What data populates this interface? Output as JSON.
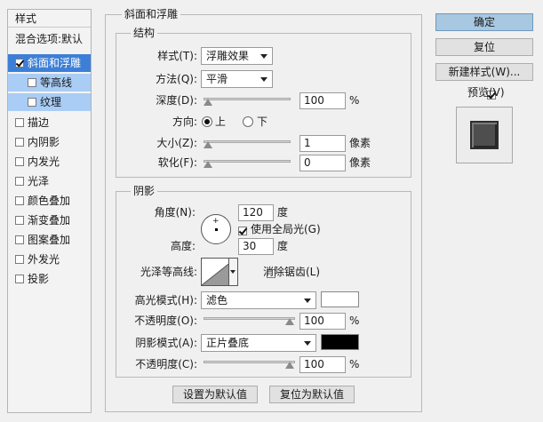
{
  "style_list": {
    "header": "样式",
    "blend_options": "混合选项:默认",
    "items": [
      {
        "label": "斜面和浮雕",
        "checked": true
      },
      {
        "label": "等高线",
        "checked": false
      },
      {
        "label": "纹理",
        "checked": false
      },
      {
        "label": "描边",
        "checked": false
      },
      {
        "label": "内阴影",
        "checked": false
      },
      {
        "label": "内发光",
        "checked": false
      },
      {
        "label": "光泽",
        "checked": false
      },
      {
        "label": "颜色叠加",
        "checked": false
      },
      {
        "label": "渐变叠加",
        "checked": false
      },
      {
        "label": "图案叠加",
        "checked": false
      },
      {
        "label": "外发光",
        "checked": false
      },
      {
        "label": "投影",
        "checked": false
      }
    ]
  },
  "panel": {
    "title": "斜面和浮雕",
    "structure": {
      "title": "结构",
      "style_label": "样式(T):",
      "style_value": "浮雕效果",
      "technique_label": "方法(Q):",
      "technique_value": "平滑",
      "depth_label": "深度(D):",
      "depth_value": "100",
      "depth_unit": "%",
      "depth_level": 0.0,
      "direction_label": "方向:",
      "direction_up": "上",
      "direction_down": "下",
      "size_label": "大小(Z):",
      "size_value": "1",
      "size_unit": "像素",
      "size_level": 0.0,
      "soften_label": "软化(F):",
      "soften_value": "0",
      "soften_unit": "像素",
      "soften_level": 0.0
    },
    "shading": {
      "title": "阴影",
      "angle_label": "角度(N):",
      "angle_value": "120",
      "angle_unit": "度",
      "global_light_label": "使用全局光(G)",
      "global_light_checked": true,
      "altitude_label": "高度:",
      "altitude_value": "30",
      "altitude_unit": "度",
      "gloss_contour_label": "光泽等高线:",
      "anti_aliased_label": "消除锯齿(L)",
      "anti_aliased_checked": false,
      "highlight_mode_label": "高光模式(H):",
      "highlight_mode_value": "滤色",
      "highlight_color": "#ffffff",
      "highlight_opacity_label": "不透明度(O):",
      "highlight_opacity_value": "100",
      "highlight_opacity_unit": "%",
      "highlight_opacity_level": 1.0,
      "shadow_mode_label": "阴影模式(A):",
      "shadow_mode_value": "正片叠底",
      "shadow_color": "#000000",
      "shadow_opacity_label": "不透明度(C):",
      "shadow_opacity_value": "100",
      "shadow_opacity_unit": "%",
      "shadow_opacity_level": 1.0
    },
    "make_default": "设置为默认值",
    "reset_default": "复位为默认值"
  },
  "right": {
    "ok": "确定",
    "reset": "复位",
    "new_style": "新建样式(W)...",
    "preview_label": "预览(V)",
    "preview_checked": true
  },
  "colors": {
    "accent": "#3d7fd6",
    "sub_selected": "#a9cdf5",
    "primary_button": "#a8c7e0"
  }
}
